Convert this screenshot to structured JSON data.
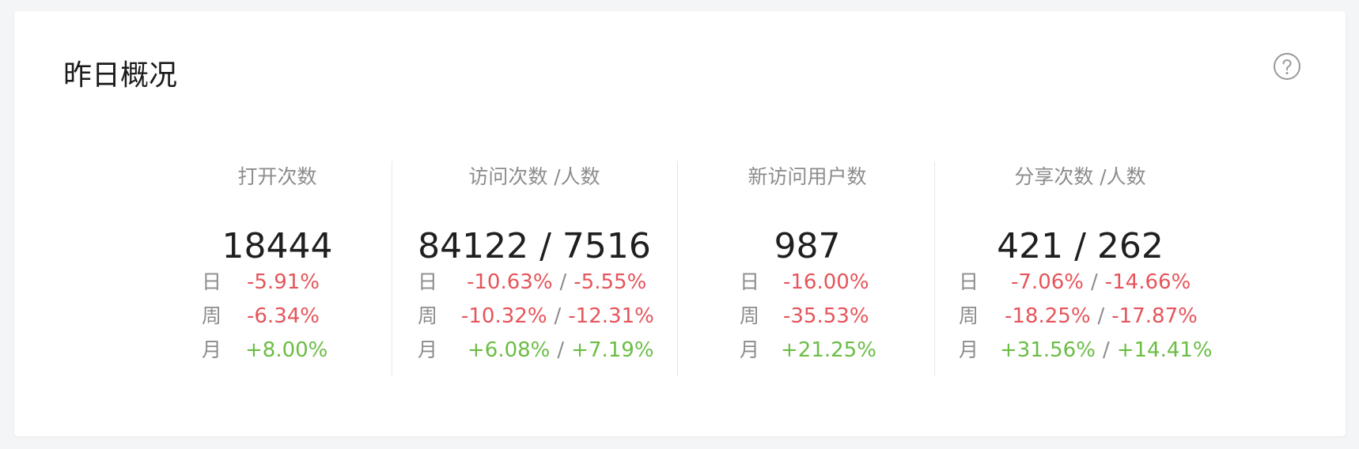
{
  "card": {
    "title": "昨日概况",
    "help_icon": "help-circle-icon"
  },
  "colors": {
    "negative": "#e5555b",
    "positive": "#6bbd45",
    "label": "#8c8c8c",
    "value": "#1f1f1f"
  },
  "periods": {
    "day": "日",
    "week": "周",
    "month": "月"
  },
  "metrics": [
    {
      "label": "打开次数",
      "value": "18444",
      "day": [
        "-5.91%"
      ],
      "week": [
        "-6.34%"
      ],
      "month": [
        "+8.00%"
      ]
    },
    {
      "label": "访问次数 /人数",
      "value": "84122 / 7516",
      "day": [
        "-10.63%",
        "-5.55%"
      ],
      "week": [
        "-10.32%",
        "-12.31%"
      ],
      "month": [
        "+6.08%",
        "+7.19%"
      ]
    },
    {
      "label": "新访问用户数",
      "value": "987",
      "day": [
        "-16.00%"
      ],
      "week": [
        "-35.53%"
      ],
      "month": [
        "+21.25%"
      ]
    },
    {
      "label": "分享次数 /人数",
      "value": "421 / 262",
      "day": [
        "-7.06%",
        "-14.66%"
      ],
      "week": [
        "-18.25%",
        "-17.87%"
      ],
      "month": [
        "+31.56%",
        "+14.41%"
      ]
    }
  ]
}
